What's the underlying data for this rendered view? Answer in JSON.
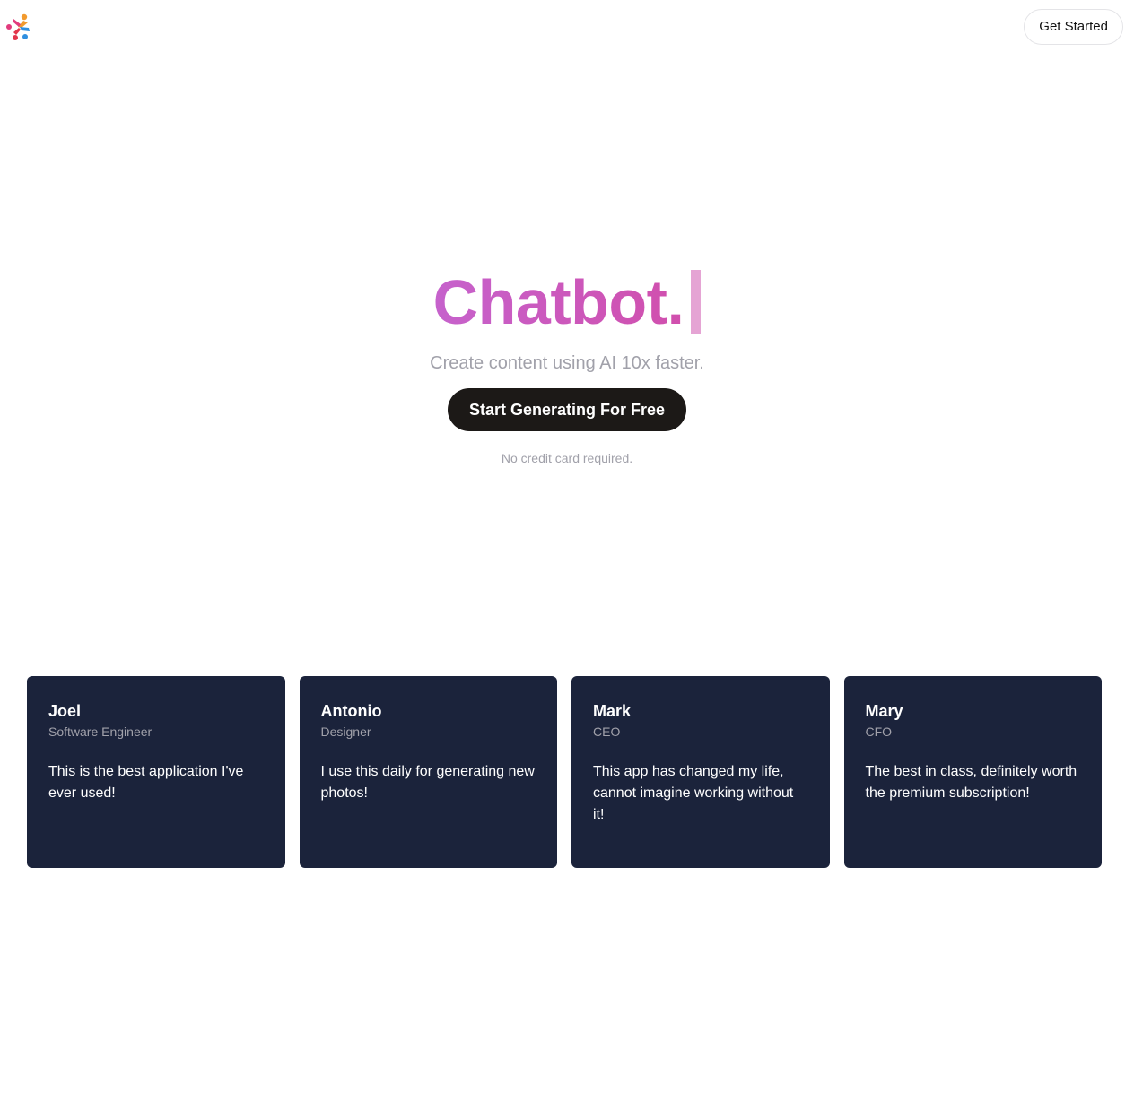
{
  "navbar": {
    "logo_icon": "pinwheel-logo-icon",
    "cta_label": "Get Started"
  },
  "hero": {
    "title": "Chatbot.",
    "subtitle": "Create content using AI 10x faster.",
    "cta_label": "Start Generating For Free",
    "note": "No credit card required."
  },
  "colors": {
    "title_gradient_start": "#c662cc",
    "title_gradient_end": "#d14fad",
    "caret": "#e5a4d4",
    "cta_background": "#1c1917",
    "card_background": "#1b233b"
  },
  "testimonials": [
    {
      "name": "Joel",
      "role": "Software Engineer",
      "quote": "This is the best application I've ever used!"
    },
    {
      "name": "Antonio",
      "role": "Designer",
      "quote": "I use this daily for generating new photos!"
    },
    {
      "name": "Mark",
      "role": "CEO",
      "quote": "This app has changed my life, cannot imagine working without it!"
    },
    {
      "name": "Mary",
      "role": "CFO",
      "quote": "The best in class, definitely worth the premium subscription!"
    }
  ]
}
